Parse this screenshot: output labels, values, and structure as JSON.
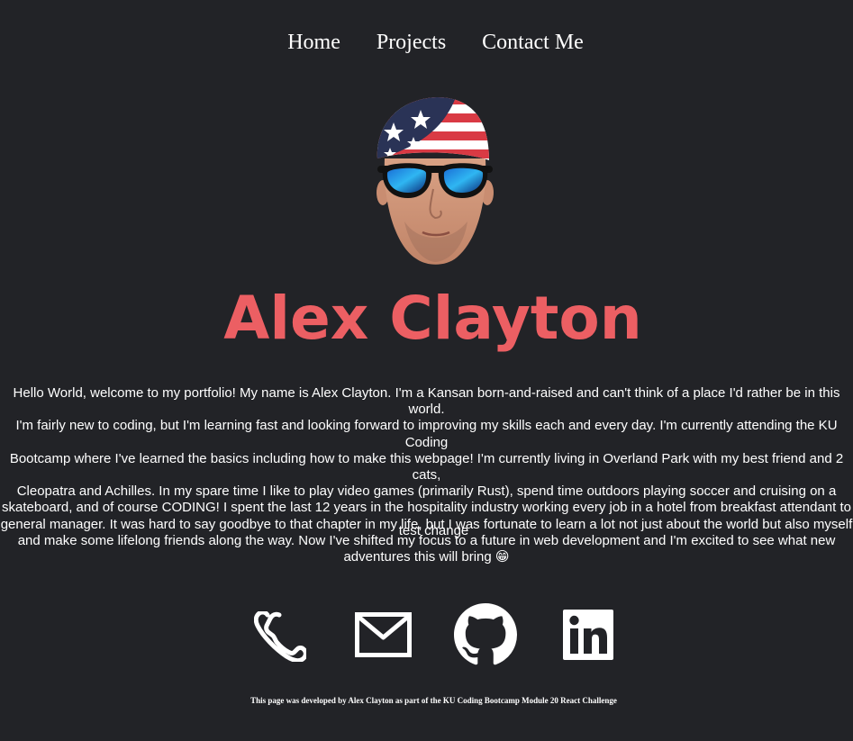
{
  "nav": {
    "items": [
      {
        "label": "Home"
      },
      {
        "label": "Projects"
      },
      {
        "label": "Contact Me"
      }
    ]
  },
  "hero": {
    "name": "Alex Clayton",
    "avatar_icon": "profile-photo",
    "name_color": "#ec5f63"
  },
  "bio": {
    "text": "Hello World, welcome to my portfolio! My name is Alex Clayton. I'm a Kansan born-and-raised and can't think of a place I'd rather be in this world.\nI'm fairly new to coding, but I'm learning fast and looking forward to improving my skills each and every day. I'm currently attending the KU Coding\nBootcamp where I've learned the basics including how to make this webpage! I'm currently living in Overland Park with my best friend and 2 cats,\nCleopatra and Achilles. In my spare time I like to play video games (primarily Rust), spend time outdoors playing soccer and cruising on a\nskateboard, and of course CODING! I spent the last 12 years in the hospitality industry working every job in a hotel from breakfast attendant to\ngeneral manager. It was hard to say goodbye to that chapter in my life, but I was fortunate to learn a lot not just about the world but also myself\nand make some lifelong friends along the way. Now I've shifted my focus to a future in web development and I'm excited to see what new\nadventures this will bring 😁",
    "test_note": "test change"
  },
  "contact": {
    "icons": [
      "phone-icon",
      "email-icon",
      "github-icon",
      "linkedin-icon"
    ]
  },
  "footer": {
    "text": "This page was developed by Alex Clayton as part of the KU Coding Bootcamp Module 20 React Challenge"
  },
  "colors": {
    "background": "#222327",
    "accent": "#ec5f63",
    "text": "#ffffff"
  }
}
